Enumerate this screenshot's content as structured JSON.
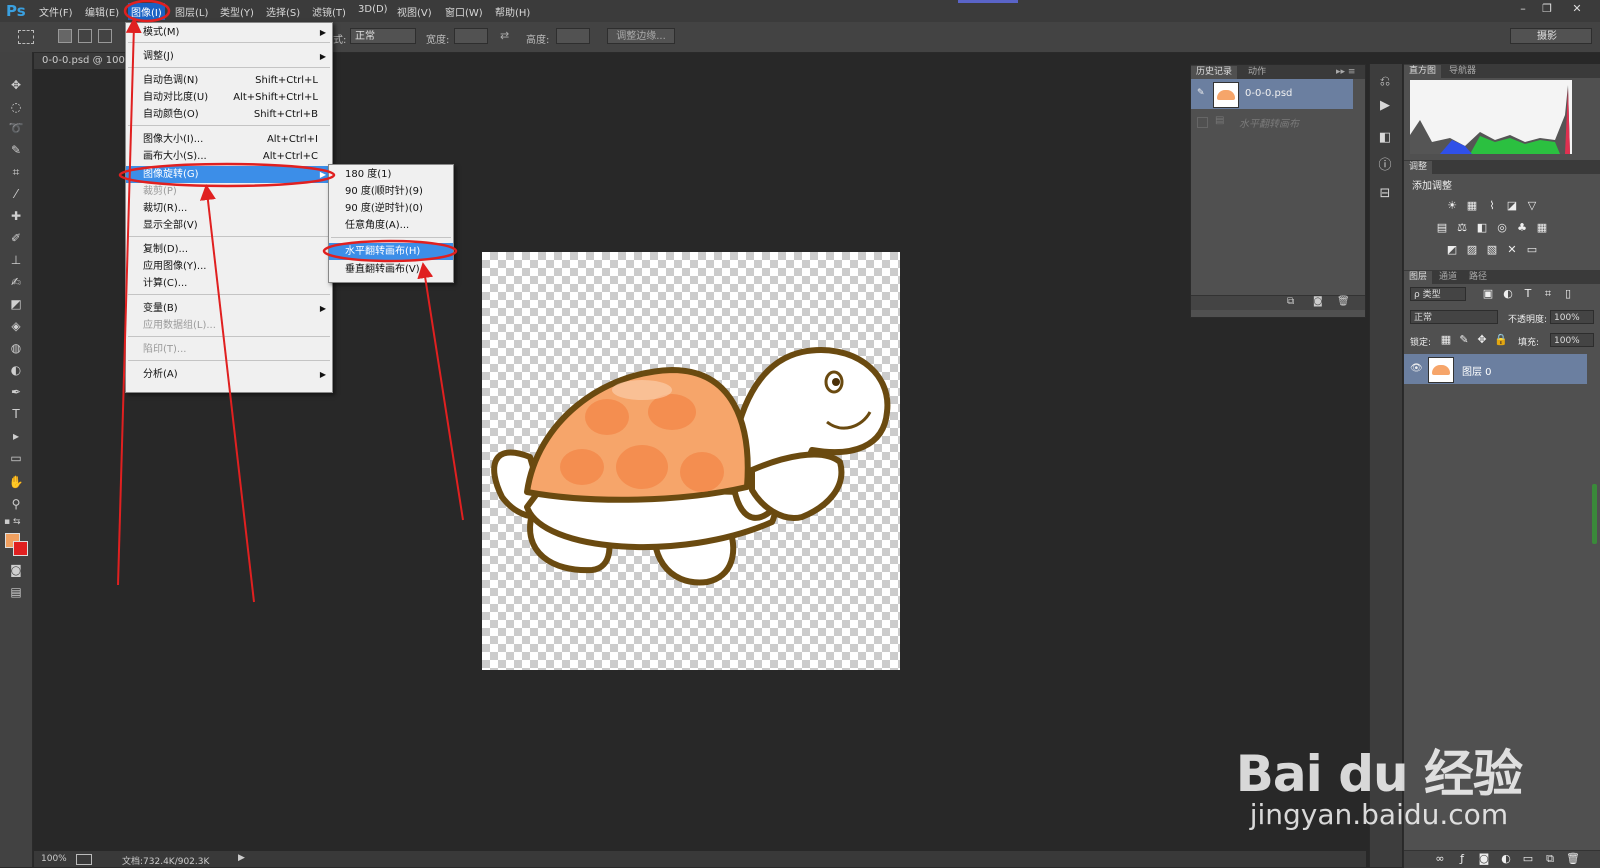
{
  "menubar": {
    "logo": "Ps",
    "items": [
      "文件(F)",
      "编辑(E)",
      "图像(I)",
      "图层(L)",
      "类型(Y)",
      "选择(S)",
      "滤镜(T)",
      "3D(D)",
      "视图(V)",
      "窗口(W)",
      "帮助(H)"
    ],
    "window_buttons": [
      "–",
      "❐",
      "✕"
    ]
  },
  "options": {
    "style_label": "式:",
    "style_value": "正常",
    "width_label": "宽度:",
    "height_label": "高度:",
    "refine_edge": "调整边缘...",
    "workspace": "摄影"
  },
  "document": {
    "tab": "0-0-0.psd @ 100%",
    "zoom": "100%",
    "doc_info": "文档:732.4K/902.3K"
  },
  "image_menu": {
    "mode": "模式(M)",
    "adjustments": "调整(J)",
    "auto_tone": "自动色调(N)",
    "auto_tone_sc": "Shift+Ctrl+L",
    "auto_contrast": "自动对比度(U)",
    "auto_contrast_sc": "Alt+Shift+Ctrl+L",
    "auto_color": "自动颜色(O)",
    "auto_color_sc": "Shift+Ctrl+B",
    "image_size": "图像大小(I)...",
    "image_size_sc": "Alt+Ctrl+I",
    "canvas_size": "画布大小(S)...",
    "canvas_size_sc": "Alt+Ctrl+C",
    "image_rotation": "图像旋转(G)",
    "crop": "裁剪(P)",
    "trim": "裁切(R)...",
    "reveal_all": "显示全部(V)",
    "duplicate": "复制(D)...",
    "apply_image": "应用图像(Y)...",
    "calculations": "计算(C)...",
    "variables": "变量(B)",
    "apply_data_set": "应用数据组(L)...",
    "trap": "陷印(T)...",
    "analysis": "分析(A)"
  },
  "rotate_submenu": {
    "r180": "180 度(1)",
    "r90cw": "90 度(顺时针)(9)",
    "r90ccw": "90 度(逆时针)(0)",
    "arbitrary": "任意角度(A)...",
    "flip_h": "水平翻转画布(H)",
    "flip_v": "垂直翻转画布(V)"
  },
  "history": {
    "tab_history": "历史记录",
    "tab_actions": "动作",
    "snapshot": "0-0-0.psd",
    "step": "水平翻转画布"
  },
  "right": {
    "tab_histogram": "直方图",
    "tab_navigator": "导航器",
    "adjust_tab": "调整",
    "add_adjust": "添加调整",
    "tab_layers": "图层",
    "tab_channels": "通道",
    "tab_paths": "路径",
    "filter_kind": "ρ 类型",
    "blend_mode": "正常",
    "opacity_label": "不透明度:",
    "opacity": "100%",
    "lock_label": "锁定:",
    "fill_label": "填充:",
    "fill": "100%",
    "layer_name": "图层 0"
  },
  "watermark": {
    "brand": "Bai du 经验",
    "url": "jingyan.baidu.com"
  },
  "colors": {
    "accent": "#3c8ee8",
    "annotation": "#e02020",
    "foreground": "#f0a060",
    "background": "#e02020"
  }
}
